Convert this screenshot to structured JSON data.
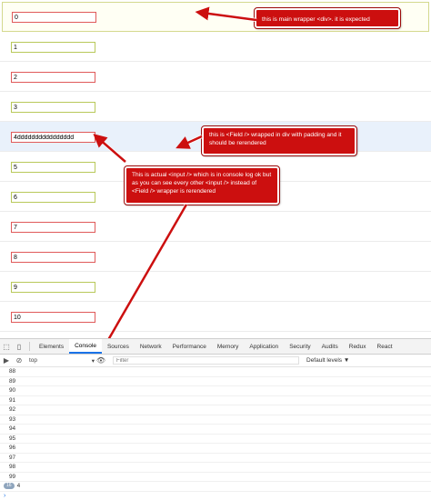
{
  "page": {
    "wrapper_value": "0",
    "fields": [
      {
        "value": "1",
        "border": "green"
      },
      {
        "value": "2",
        "border": "red"
      },
      {
        "value": "3",
        "border": "green"
      },
      {
        "value": "4dddddddddddddddd",
        "border": "red"
      },
      {
        "value": "5",
        "border": "green"
      },
      {
        "value": "6",
        "border": "green"
      },
      {
        "value": "7",
        "border": "red"
      },
      {
        "value": "8",
        "border": "red"
      },
      {
        "value": "9",
        "border": "green"
      },
      {
        "value": "10",
        "border": "red"
      }
    ]
  },
  "annotations": {
    "wrapper_note": "this is main wrapper <div>. it is expected",
    "field_note": "this is <Field /> wrapped in div with padding and it should be rerendered",
    "input_note": "This is actual <input /> which is in console log ok but as you can see every other <input /> instead of <Field /> wrapper is rerendered"
  },
  "devtools": {
    "tabs": [
      "Elements",
      "Console",
      "Sources",
      "Network",
      "Performance",
      "Memory",
      "Application",
      "Security",
      "Audits",
      "Redux",
      "React"
    ],
    "active_tab": "Console",
    "context": "top",
    "filter_placeholder": "Filter",
    "levels_label": "Default levels ▼",
    "log_lines": [
      "88",
      "89",
      "90",
      "91",
      "92",
      "93",
      "94",
      "95",
      "96",
      "97",
      "98",
      "99"
    ],
    "last_badge": "16",
    "last_value": "4",
    "prompt": "›"
  },
  "colors": {
    "annotation_red": "#cc0f0f",
    "red_border": "#e05a5a",
    "green_border": "#b8c95a",
    "active_tab": "#1a73e8"
  }
}
